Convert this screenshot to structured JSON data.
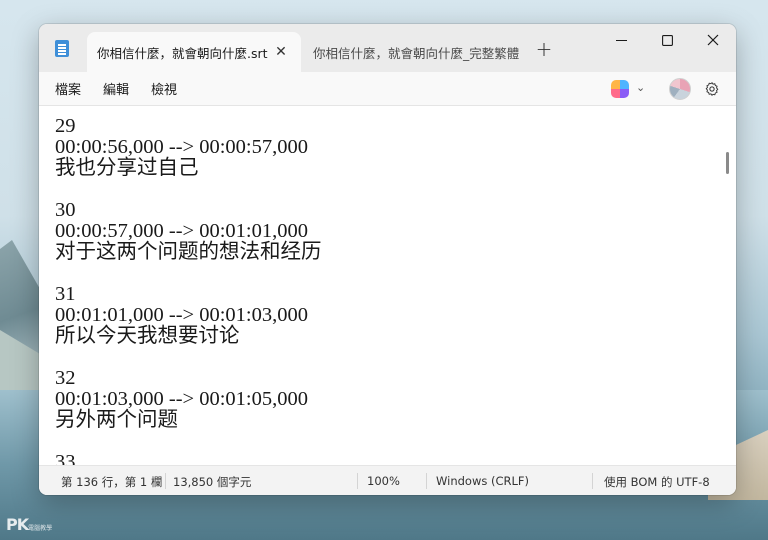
{
  "window": {
    "tabs": [
      {
        "label": "你相信什麼，就會朝向什麼.srt",
        "active": true
      },
      {
        "label": "你相信什麼，就會朝向什麼_完整繁體.s",
        "active": false
      }
    ],
    "new_tab_label": "+",
    "controls": {
      "minimize": "—",
      "maximize": "☐",
      "close": "✕"
    }
  },
  "menu": {
    "items": [
      "檔案",
      "編輯",
      "檢視"
    ]
  },
  "editor": {
    "lines": [
      "29",
      "00:00:56,000 --> 00:00:57,000",
      "我也分享过自己",
      "",
      "30",
      "00:00:57,000 --> 00:01:01,000",
      "对于这两个问题的想法和经历",
      "",
      "31",
      "00:01:01,000 --> 00:01:03,000",
      "所以今天我想要讨论",
      "",
      "32",
      "00:01:03,000 --> 00:01:05,000",
      "另外两个问题",
      "",
      "33"
    ]
  },
  "status": {
    "position": "第 136 行，第 1 欄",
    "char_count": "13,850 個字元",
    "zoom": "100%",
    "line_ending": "Windows (CRLF)",
    "encoding": "使用 BOM 的 UTF-8"
  },
  "watermark": {
    "text": "PK",
    "sub": "電腦教學"
  },
  "colors": {
    "window_bg": "#f9f9f9",
    "titlebar_bg": "#ebebeb",
    "editor_bg": "#ffffff",
    "status_bg": "#f3f3f3"
  }
}
